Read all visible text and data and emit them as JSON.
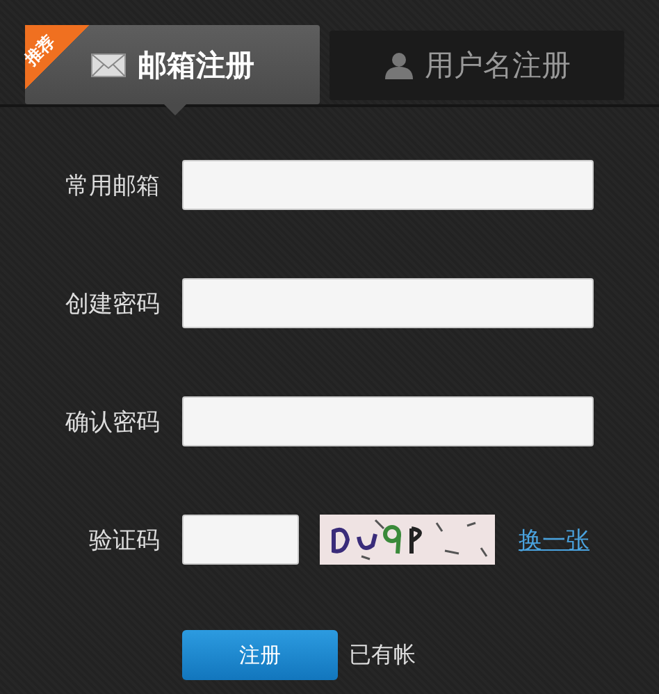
{
  "tabs": [
    {
      "label": "邮箱注册",
      "kind": "mail",
      "badge": "推荐",
      "selected": true
    },
    {
      "label": "用户名注册",
      "kind": "user",
      "selected": false
    }
  ],
  "fields": [
    {
      "label": "常用邮箱",
      "kind": "text"
    },
    {
      "label": "创建密码",
      "kind": "text"
    },
    {
      "label": "确认密码",
      "kind": "text"
    },
    {
      "label": "验证码",
      "kind": "captcha",
      "refresh_link": "换一张"
    }
  ],
  "submit_button": "注册",
  "login_hint": "已有帐"
}
